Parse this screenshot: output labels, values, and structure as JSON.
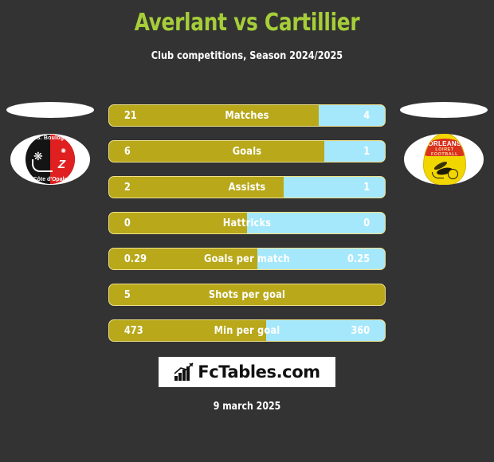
{
  "header": {
    "title": "Averlant vs Cartillier",
    "subtitle": "Club competitions, Season 2024/2025",
    "title_color": "#a6ce39"
  },
  "colors": {
    "background": "#333333",
    "home_bar": "#b8a81a",
    "away_bar": "#a5e8fb",
    "bar_border": "#f0e08a",
    "text": "#ffffff"
  },
  "teams": {
    "home": {
      "name_line1": "S. Boulog",
      "name_line2": "Côte d'Opale",
      "colors": [
        "#141414",
        "#e02020"
      ]
    },
    "away": {
      "name_line1": "ORLEANS",
      "name_line2": "LOIRET",
      "name_line3": "FOOTBALL",
      "colors": [
        "#f2d600",
        "#d9321f"
      ]
    }
  },
  "stats": [
    {
      "label": "Matches",
      "home": "21",
      "away": "4",
      "home_pct": 75.9
    },
    {
      "label": "Goals",
      "home": "6",
      "away": "1",
      "home_pct": 78.0
    },
    {
      "label": "Assists",
      "home": "2",
      "away": "1",
      "home_pct": 63.2
    },
    {
      "label": "Hattricks",
      "home": "0",
      "away": "0",
      "home_pct": 50.0
    },
    {
      "label": "Goals per match",
      "home": "0.29",
      "away": "0.25",
      "home_pct": 53.7
    },
    {
      "label": "Shots per goal",
      "home": "5",
      "away": "",
      "home_pct": 100.0
    },
    {
      "label": "Min per goal",
      "home": "473",
      "away": "360",
      "home_pct": 56.8
    }
  ],
  "footer": {
    "brand": "FcTables.com",
    "brand_icon": "bar-chart-trend-icon",
    "date": "9 march 2025"
  }
}
